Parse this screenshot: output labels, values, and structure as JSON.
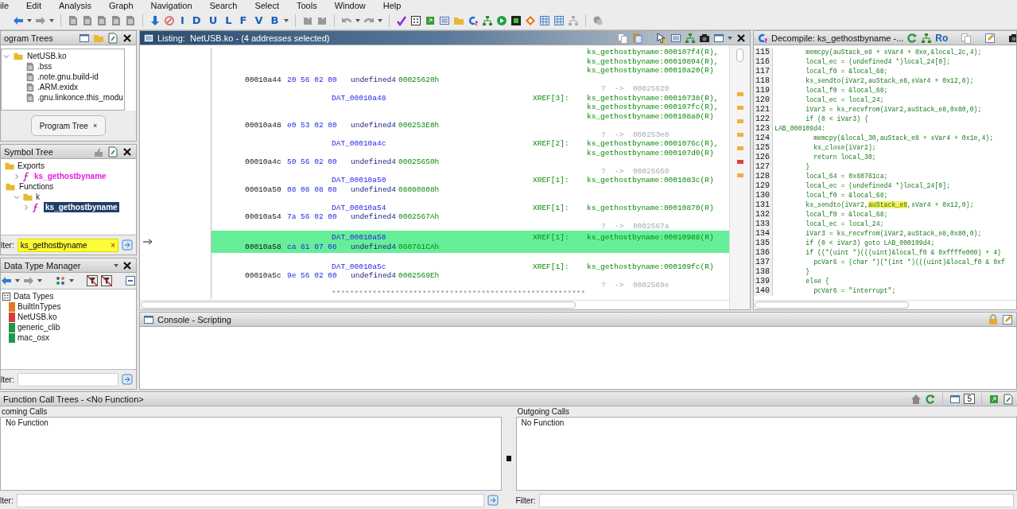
{
  "menu": [
    "ile",
    "Edit",
    "Analysis",
    "Graph",
    "Navigation",
    "Search",
    "Select",
    "Tools",
    "Window",
    "Help"
  ],
  "toolbar": {
    "letters": [
      "I",
      "D",
      "U",
      "L",
      "F",
      "V",
      "B"
    ]
  },
  "program_trees": {
    "title": "ogram Trees",
    "items": [
      {
        "label": "NetUSB.ko",
        "expanded": true,
        "children": [
          {
            "label": ".bss"
          },
          {
            "label": ".note.gnu.build-id"
          },
          {
            "label": ".ARM.exidx"
          },
          {
            "label": ".gnu.linkonce.this_modu"
          }
        ]
      }
    ],
    "tab": {
      "label": "Program Tree",
      "close": "×"
    }
  },
  "symbol_tree": {
    "title": "Symbol Tree",
    "items": [
      {
        "label": "Exports",
        "kind": "folder",
        "selected": false,
        "children": [
          {
            "label": "ks_gethostbyname",
            "kind": "function",
            "expanded": false,
            "selected": false
          }
        ]
      },
      {
        "label": "Functions",
        "kind": "functions_folder",
        "selected": false,
        "children": [
          {
            "label": "k",
            "kind": "folder",
            "expanded": true,
            "selected": false,
            "children": [
              {
                "label": "ks_gethostbyname",
                "kind": "function",
                "expanded": false,
                "selected": true
              }
            ]
          }
        ]
      }
    ],
    "filter_label": "lter:",
    "filter_value": "ks_gethostbyname",
    "filter_clear": "×"
  },
  "data_type_manager": {
    "title": "Data Type Manager",
    "root": "Data Types",
    "items": [
      {
        "label": "BuiltInTypes",
        "color": "#e07b20"
      },
      {
        "label": "NetUSB.ko",
        "color": "#d93a3a"
      },
      {
        "label": "generic_clib",
        "color": "#1c9a4c"
      },
      {
        "label": "mac_osx",
        "color": "#1c9a4c"
      }
    ],
    "filter_label": "lter:"
  },
  "listing": {
    "title": "Listing:  NetUSB.ko - (4 addresses selected)",
    "entries": [
      {
        "xrefs": [
          "ks_gethostbyname:000107f4(R),",
          "ks_gethostbyname:00010894(R),",
          "ks_gethostbyname:00010a20(R)"
        ],
        "address": "00010a44",
        "bytes": "20 56 02 00",
        "datatype": "undefined4",
        "value": "00025620h",
        "pointer": "?  ->  00025620",
        "highlighted": false
      },
      {
        "label": "DAT_00010a48",
        "xref_count": "XREF[3]:",
        "xrefs": [
          "ks_gethostbyname:00010738(R),",
          "ks_gethostbyname:000107fc(R),",
          "ks_gethostbyname:000108a0(R)"
        ],
        "address": "00010a48",
        "bytes": "e0 53 02 00",
        "datatype": "undefined4",
        "value": "000253E0h",
        "pointer": "?  ->  000253e0",
        "highlighted": false
      },
      {
        "label": "DAT_00010a4c",
        "xref_count": "XREF[2]:",
        "xrefs": [
          "ks_gethostbyname:0001076c(R),",
          "ks_gethostbyname:000107d0(R)"
        ],
        "address": "00010a4c",
        "bytes": "50 56 02 00",
        "datatype": "undefined4",
        "value": "00025650h",
        "pointer": "?  ->  00025650",
        "highlighted": false
      },
      {
        "label": "DAT_00010a50",
        "xref_count": "XREF[1]:",
        "xrefs": [
          "ks_gethostbyname:0001083c(R)"
        ],
        "address": "00010a50",
        "bytes": "08 08 08 08",
        "datatype": "undefined4",
        "value": "08080808h",
        "highlighted": false
      },
      {
        "label": "DAT_00010a54",
        "xref_count": "XREF[1]:",
        "xrefs": [
          "ks_gethostbyname:00010870(R)"
        ],
        "address": "00010a54",
        "bytes": "7a 56 02 00",
        "datatype": "undefined4",
        "value": "0002567Ah",
        "pointer": "?  ->  0002567a",
        "highlighted": false
      },
      {
        "label": "DAT_00010a58",
        "xref_count": "XREF[1]:",
        "xrefs": [
          "ks_gethostbyname:00010988(R)"
        ],
        "address": "00010a58",
        "bytes": "ca 61 07 06",
        "datatype": "undefined4",
        "value": "060761CAh",
        "highlighted": true
      },
      {
        "label": "DAT_00010a5c",
        "xref_count": "XREF[1]:",
        "xrefs": [
          "ks_gethostbyname:000109fc(R)"
        ],
        "address": "00010a5c",
        "bytes": "9e 56 02 00",
        "datatype": "undefined4",
        "value": "0002569Eh",
        "pointer": "?  ->  0002569e",
        "highlighted": false
      }
    ],
    "separator": "********************************************************"
  },
  "decompile": {
    "title": "Decompile: ks_gethostbyname -...",
    "badge": "Ro",
    "lines": [
      {
        "number": "115",
        "code": "        memcpy(auStack_e8 + sVar4 + 0xe,&local_2c,4);"
      },
      {
        "number": "116",
        "code": "        local_ec = (undefined4 *)local_24[0];"
      },
      {
        "number": "117",
        "code": "        local_f0 = &local_68;"
      },
      {
        "number": "118",
        "code": "        ks_sendto(iVar2,auStack_e8,sVar4 + 0x12,0);"
      },
      {
        "number": "119",
        "code": "        local_f0 = &local_68;"
      },
      {
        "number": "120",
        "code": "        local_ec = local_24;"
      },
      {
        "number": "121",
        "code": "        iVar3 = ks_recvfrom(iVar2,auStack_e8,0x80,0);"
      },
      {
        "number": "122",
        "code": "        if (0 < iVar3) {"
      },
      {
        "number": "123",
        "code": "LAB_000109d4:"
      },
      {
        "number": "124",
        "code": "          memcpy(&local_30,auStack_e8 + sVar4 + 0x1e,4);"
      },
      {
        "number": "125",
        "code": "          ks_close(iVar2);"
      },
      {
        "number": "126",
        "code": "          return local_30;"
      },
      {
        "number": "127",
        "code": "        }"
      },
      {
        "number": "128",
        "code": "        local_64 = 0x60761ca;"
      },
      {
        "number": "129",
        "code": "        local_ec = (undefined4 *)local_24[0];"
      },
      {
        "number": "130",
        "code": "        local_f0 = &local_68;"
      },
      {
        "number": "131",
        "code": "        ks_sendto(iVar2,",
        "highlight": "auStack_e8",
        "code_after": ",sVar4 + 0x12,0);"
      },
      {
        "number": "132",
        "code": "        local_f0 = &local_68;"
      },
      {
        "number": "133",
        "code": "        local_ec = local_24;"
      },
      {
        "number": "134",
        "code": "        iVar3 = ks_recvfrom(iVar2,auStack_e8,0x80,0);"
      },
      {
        "number": "135",
        "code": "        if (0 < iVar3) goto LAB_000109d4;"
      },
      {
        "number": "136",
        "code": "        if ((*(uint *)(((uint)&local_f0 & 0xffffe000) + 4)"
      },
      {
        "number": "137",
        "code": "          pcVar6 = (char *)(*(int *)(((uint)&local_f0 & 0xf"
      },
      {
        "number": "138",
        "code": "        }"
      },
      {
        "number": "139",
        "code": "        else {"
      },
      {
        "number": "140",
        "code": "          pcVar6 = \"interrupt\";"
      }
    ]
  },
  "console": {
    "title": "Console - Scripting"
  },
  "call_trees": {
    "title": "Function Call Trees - <No Function>",
    "count": "5",
    "incoming": {
      "title": "coming Calls",
      "items": [
        "No Function"
      ],
      "filter_label": "lter:"
    },
    "outgoing": {
      "title": "Outgoing Calls",
      "items": [
        "No Function"
      ],
      "filter_label": "Filter:"
    }
  }
}
